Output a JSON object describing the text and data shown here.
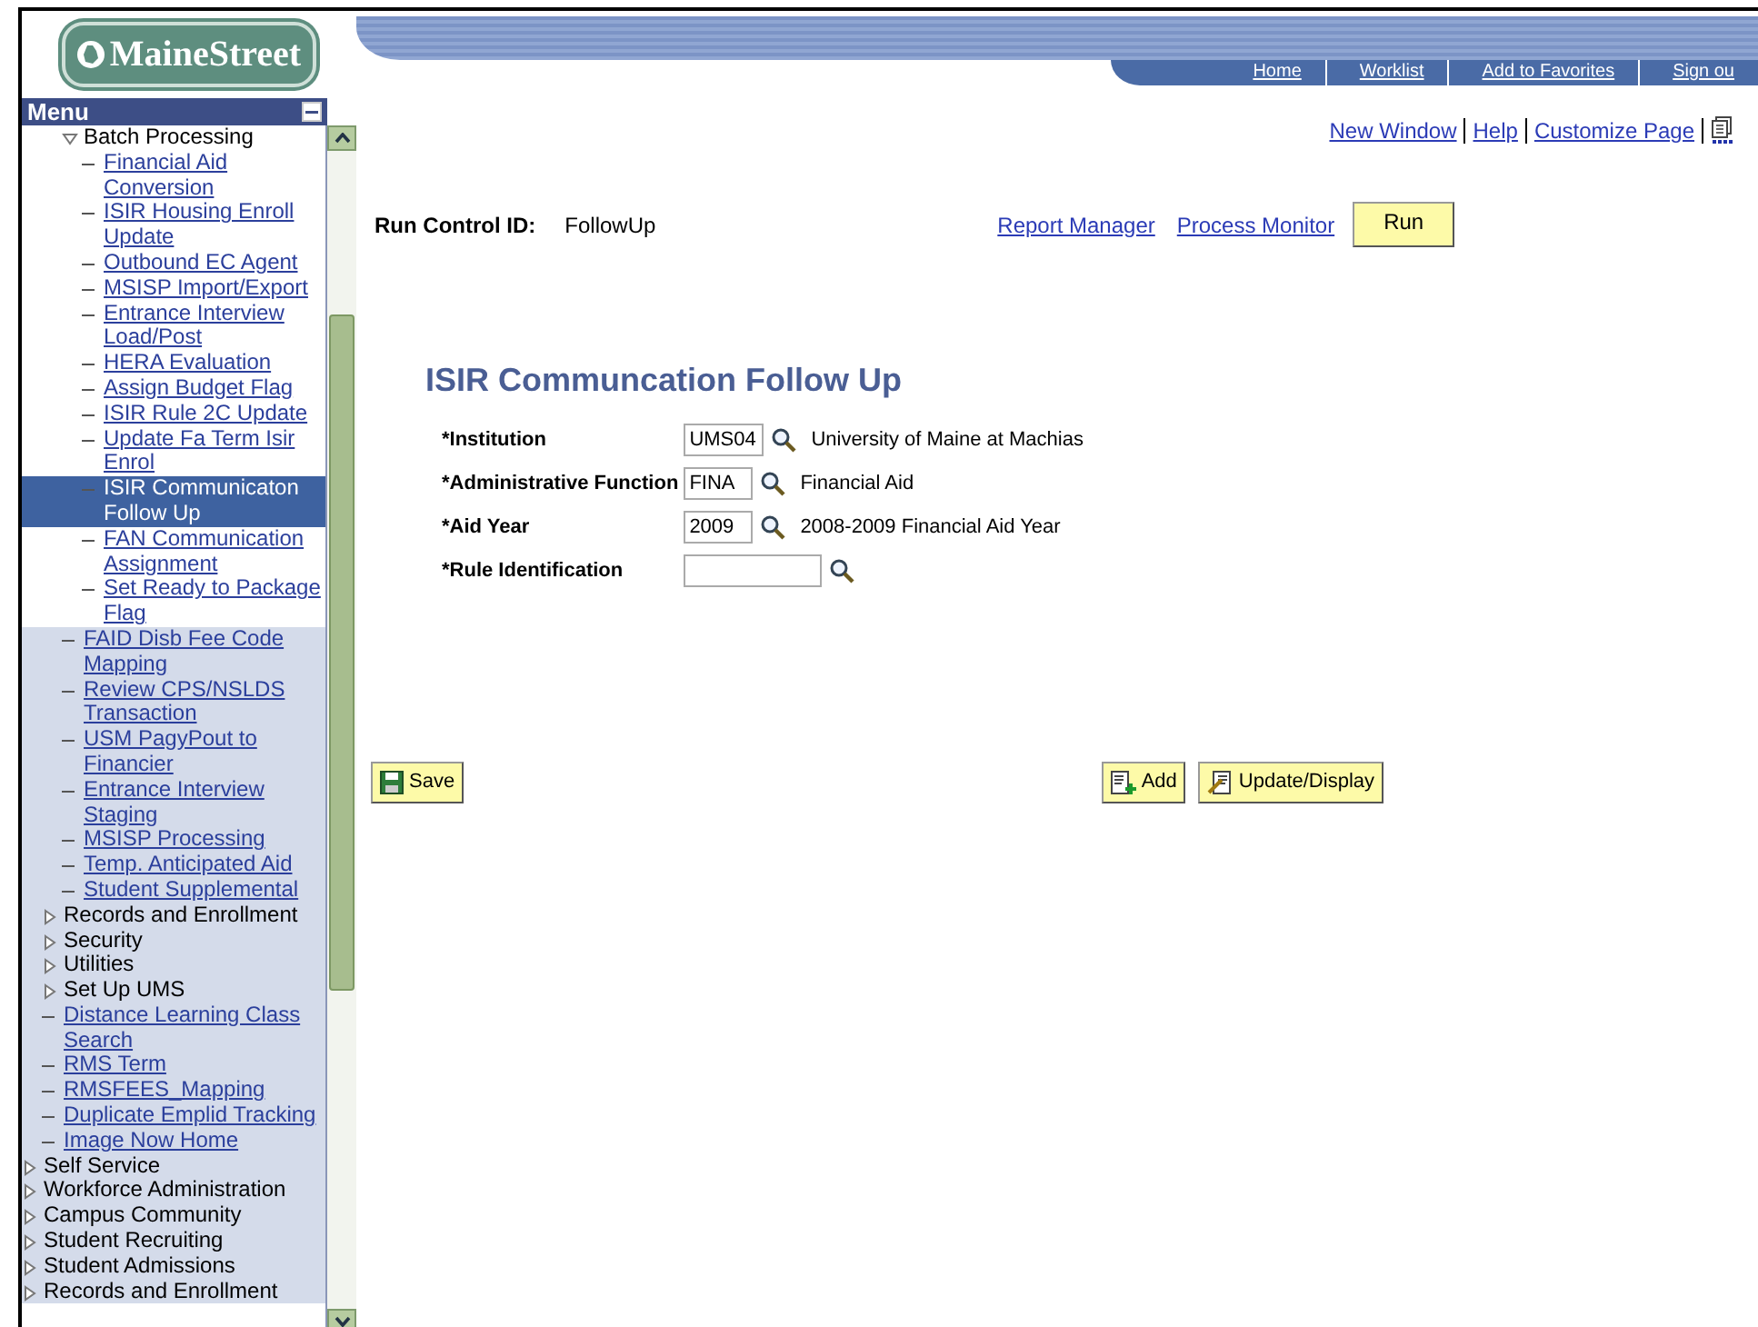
{
  "logo": "MaineStreet",
  "menu": {
    "title": "Menu",
    "items": [
      {
        "kind": "group",
        "children": [
          {
            "kind": "group",
            "children": [
              {
                "kind": "folder",
                "label": "Batch Processing",
                "expanded": true,
                "shaded": false,
                "children": [
                  {
                    "kind": "link",
                    "label": "Financial Aid Conversion",
                    "selected": false,
                    "shaded": false
                  },
                  {
                    "kind": "link",
                    "label": "ISIR Housing Enroll Update",
                    "selected": false,
                    "shaded": false
                  },
                  {
                    "kind": "link",
                    "label": "Outbound EC Agent",
                    "selected": false,
                    "shaded": false
                  },
                  {
                    "kind": "link",
                    "label": "MSISP Import/Export",
                    "selected": false,
                    "shaded": false
                  },
                  {
                    "kind": "link",
                    "label": "Entrance Interview Load/Post",
                    "selected": false,
                    "shaded": false
                  },
                  {
                    "kind": "link",
                    "label": "HERA Evaluation",
                    "selected": false,
                    "shaded": false
                  },
                  {
                    "kind": "link",
                    "label": "Assign Budget Flag",
                    "selected": false,
                    "shaded": false
                  },
                  {
                    "kind": "link",
                    "label": "ISIR Rule 2C Update",
                    "selected": false,
                    "shaded": false
                  },
                  {
                    "kind": "link",
                    "label": "Update Fa Term Isir Enrol",
                    "selected": false,
                    "shaded": false
                  },
                  {
                    "kind": "link",
                    "label": "ISIR Communicaton Follow Up",
                    "selected": true,
                    "shaded": false
                  },
                  {
                    "kind": "link",
                    "label": "FAN Communication Assignment",
                    "selected": false,
                    "shaded": false
                  },
                  {
                    "kind": "link",
                    "label": "Set Ready to Package Flag",
                    "selected": false,
                    "shaded": false
                  }
                ]
              },
              {
                "kind": "link",
                "label": "FAID Disb Fee Code Mapping",
                "selected": false,
                "shaded": true
              },
              {
                "kind": "link",
                "label": "Review CPS/NSLDS Transaction",
                "selected": false,
                "shaded": true
              },
              {
                "kind": "link",
                "label": "USM PagyPout to Financier",
                "selected": false,
                "shaded": true
              },
              {
                "kind": "link",
                "label": "Entrance Interview Staging",
                "selected": false,
                "shaded": true
              },
              {
                "kind": "link",
                "label": "MSISP Processing",
                "selected": false,
                "shaded": true
              },
              {
                "kind": "link",
                "label": "Temp. Anticipated Aid",
                "selected": false,
                "shaded": true
              },
              {
                "kind": "link",
                "label": "Student Supplemental",
                "selected": false,
                "shaded": true
              }
            ]
          },
          {
            "kind": "folder",
            "label": "Records and Enrollment",
            "expanded": false,
            "shaded": true
          },
          {
            "kind": "folder",
            "label": "Security",
            "expanded": false,
            "shaded": true
          },
          {
            "kind": "folder",
            "label": "Utilities",
            "expanded": false,
            "shaded": true
          },
          {
            "kind": "folder",
            "label": "Set Up UMS",
            "expanded": false,
            "shaded": true
          },
          {
            "kind": "link",
            "label": "Distance Learning Class Search",
            "selected": false,
            "shaded": true
          },
          {
            "kind": "link",
            "label": "RMS Term",
            "selected": false,
            "shaded": true
          },
          {
            "kind": "link",
            "label": "RMSFEES_Mapping",
            "selected": false,
            "shaded": true
          },
          {
            "kind": "link",
            "label": "Duplicate Emplid Tracking",
            "selected": false,
            "shaded": true
          },
          {
            "kind": "link",
            "label": "Image Now Home",
            "selected": false,
            "shaded": true
          }
        ]
      },
      {
        "kind": "folder",
        "label": "Self Service",
        "expanded": false,
        "shaded": true
      },
      {
        "kind": "folder",
        "label": "Workforce Administration",
        "expanded": false,
        "shaded": true
      },
      {
        "kind": "folder",
        "label": "Campus Community",
        "expanded": false,
        "shaded": true
      },
      {
        "kind": "folder",
        "label": "Student Recruiting",
        "expanded": false,
        "shaded": true
      },
      {
        "kind": "folder",
        "label": "Student Admissions",
        "expanded": false,
        "shaded": true
      },
      {
        "kind": "folder",
        "label": "Records and Enrollment",
        "expanded": false,
        "shaded": true
      }
    ]
  },
  "header_links": [
    "Home",
    "Worklist",
    "Add to Favorites",
    "Sign ou"
  ],
  "page_links": [
    "New Window",
    "Help",
    "Customize Page"
  ],
  "run_control": {
    "label": "Run Control ID:",
    "value": "FollowUp",
    "links": [
      "Report Manager",
      "Process Monitor"
    ],
    "run_button": "Run"
  },
  "title": "ISIR Communcation Follow Up",
  "fields": [
    {
      "label": "*Institution",
      "value": "UMS04",
      "description": "University of Maine at Machias"
    },
    {
      "label": "*Administrative Function",
      "value": "FINA",
      "description": "Financial Aid"
    },
    {
      "label": "*Aid Year",
      "value": "2009",
      "description": "2008-2009 Financial Aid Year"
    },
    {
      "label": "*Rule Identification"
    }
  ],
  "buttons": [
    {
      "kind": "save",
      "label": "Save"
    },
    {
      "kind": "add",
      "label": "Add"
    },
    {
      "kind": "update",
      "label": "Update/Display"
    }
  ]
}
